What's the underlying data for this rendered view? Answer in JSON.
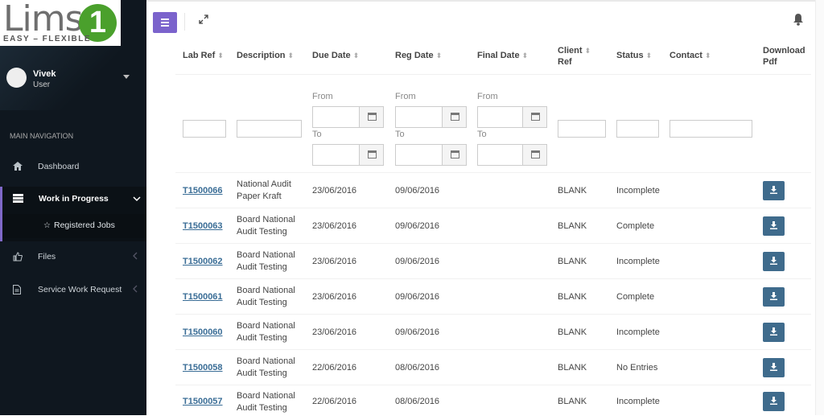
{
  "brand": {
    "logo_text": "Lims",
    "logo_digit": "1",
    "tagline": "EASY – FLEXIBLE",
    "accent_green": "#4aa02c",
    "accent_purple": "#7b63cc"
  },
  "user": {
    "name": "Vivek",
    "role": "User"
  },
  "sidebar": {
    "header": "MAIN NAVIGATION",
    "items": [
      {
        "label": "Dashboard",
        "icon": "home-icon"
      },
      {
        "label": "Work in Progress",
        "icon": "list-icon",
        "active": true
      },
      {
        "label": "Files",
        "icon": "thumbs-up-icon"
      },
      {
        "label": "Service Work Request",
        "icon": "document-icon"
      }
    ],
    "subitem": {
      "label": "Registered Jobs",
      "icon": "star-icon"
    }
  },
  "table": {
    "headers": {
      "lab_ref": "Lab Ref",
      "description": "Description",
      "due_date": "Due Date",
      "reg_date": "Reg Date",
      "final_date": "Final Date",
      "client_ref_1": "Client",
      "client_ref_2": "Ref",
      "status": "Status",
      "contact": "Contact",
      "download_1": "Download",
      "download_2": "Pdf"
    },
    "filters": {
      "from": "From",
      "to": "To"
    },
    "rows": [
      {
        "lab_ref": "T1500066",
        "desc1": "National Audit",
        "desc2": "Paper Kraft",
        "due": "23/06/2016",
        "reg": "09/06/2016",
        "client": "BLANK",
        "status": "Incomplete"
      },
      {
        "lab_ref": "T1500063",
        "desc1": "Board National",
        "desc2": "Audit Testing",
        "due": "23/06/2016",
        "reg": "09/06/2016",
        "client": "BLANK",
        "status": "Complete"
      },
      {
        "lab_ref": "T1500062",
        "desc1": "Board National",
        "desc2": "Audit Testing",
        "due": "23/06/2016",
        "reg": "09/06/2016",
        "client": "BLANK",
        "status": "Incomplete"
      },
      {
        "lab_ref": "T1500061",
        "desc1": "Board National",
        "desc2": "Audit Testing",
        "due": "23/06/2016",
        "reg": "09/06/2016",
        "client": "BLANK",
        "status": "Complete"
      },
      {
        "lab_ref": "T1500060",
        "desc1": "Board National",
        "desc2": "Audit Testing",
        "due": "23/06/2016",
        "reg": "09/06/2016",
        "client": "BLANK",
        "status": "Incomplete"
      },
      {
        "lab_ref": "T1500058",
        "desc1": "Board National",
        "desc2": "Audit Testing",
        "due": "22/06/2016",
        "reg": "08/06/2016",
        "client": "BLANK",
        "status": "No Entries"
      },
      {
        "lab_ref": "T1500057",
        "desc1": "Board National",
        "desc2": "Audit Testing",
        "due": "22/06/2016",
        "reg": "08/06/2016",
        "client": "BLANK",
        "status": "Incomplete"
      }
    ]
  }
}
